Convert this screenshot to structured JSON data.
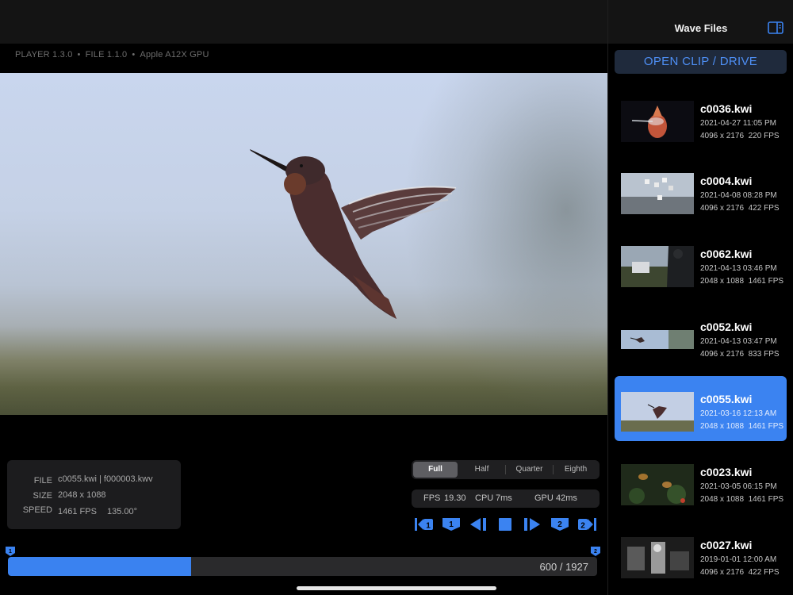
{
  "header": {
    "info": [
      "PLAYER 1.3.0",
      "FILE 1.1.0",
      "Apple A12X GPU"
    ]
  },
  "meta": {
    "file_label": "FILE",
    "file_value": "c0055.kwi | f000003.kwv",
    "size_label": "SIZE",
    "size_value": "2048 x 1088",
    "speed_label": "SPEED",
    "speed_value": "1461 FPS",
    "shutter_value": "135.00°"
  },
  "resolution": {
    "options": [
      "Full",
      "Half",
      "Quarter",
      "Eighth"
    ],
    "selected": "Full"
  },
  "stats": {
    "fps_label": "FPS",
    "fps_value": "19.30",
    "cpu_label": "CPU",
    "cpu_value": "7ms",
    "gpu_label": "GPU",
    "gpu_value": "42ms"
  },
  "transport": {
    "icons": [
      "jump-to-marker-1-icon",
      "set-marker-1-icon",
      "step-back-icon",
      "stop-icon",
      "step-forward-icon",
      "set-marker-2-icon",
      "jump-to-marker-2-icon"
    ],
    "marker_1_label": "1",
    "marker_2_label": "2"
  },
  "timeline": {
    "current": 600,
    "total": 1927,
    "counter_text": "600 / 1927",
    "progress": 0.311,
    "marker_1": "1",
    "marker_2": "2"
  },
  "sidebar": {
    "title": "Wave Files",
    "open_button": "OPEN CLIP / DRIVE",
    "clips": [
      {
        "name": "c0036.kwi",
        "date": "2021-04-27 11:05 PM",
        "resolution": "4096 x 2176",
        "fps": "220 FPS",
        "selected": false
      },
      {
        "name": "c0004.kwi",
        "date": "2021-04-08 08:28 PM",
        "resolution": "4096 x 2176",
        "fps": "422 FPS",
        "selected": false
      },
      {
        "name": "c0062.kwi",
        "date": "2021-04-13 03:46 PM",
        "resolution": "2048 x 1088",
        "fps": "1461 FPS",
        "selected": false
      },
      {
        "name": "c0052.kwi",
        "date": "2021-04-13 03:47 PM",
        "resolution": "4096 x 2176",
        "fps": "833 FPS",
        "selected": false
      },
      {
        "name": "c0055.kwi",
        "date": "2021-03-16 12:13 AM",
        "resolution": "2048 x 1088",
        "fps": "1461 FPS",
        "selected": true
      },
      {
        "name": "c0023.kwi",
        "date": "2021-03-05 06:15 PM",
        "resolution": "2048 x 1088",
        "fps": "1461 FPS",
        "selected": false
      },
      {
        "name": "c0027.kwi",
        "date": "2019-01-01 12:00 AM",
        "resolution": "4096 x 2176",
        "fps": "422 FPS",
        "selected": false
      }
    ]
  },
  "colors": {
    "accent": "#3b83f1",
    "panel": "#1c1c1e",
    "background": "#000000"
  }
}
